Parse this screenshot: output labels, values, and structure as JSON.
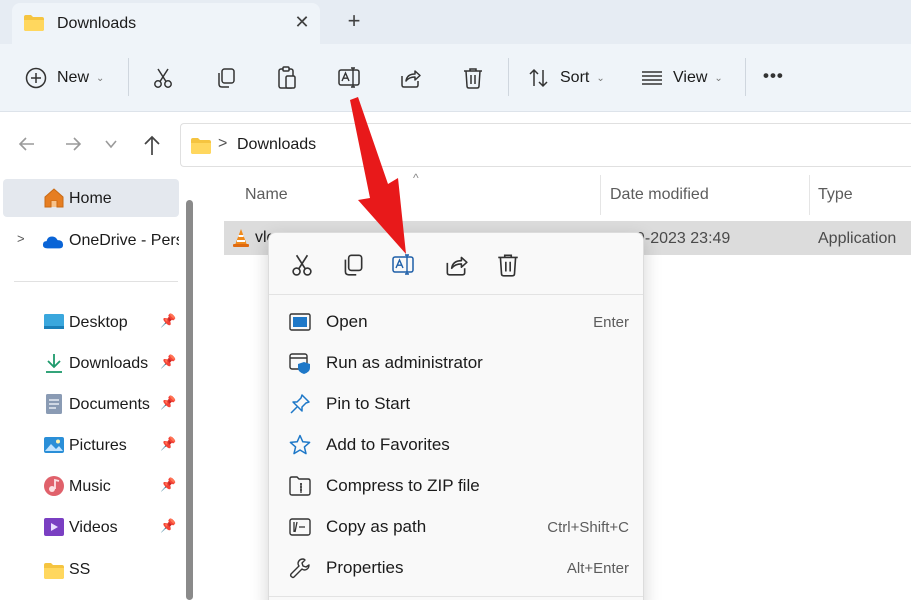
{
  "tab": {
    "title": "Downloads",
    "close": "✕",
    "new_tab": "+"
  },
  "toolbar": {
    "new_label": "New",
    "sort_label": "Sort",
    "view_label": "View",
    "more": "•••",
    "chevron": "⌄"
  },
  "address": {
    "separator": ">",
    "crumb": "Downloads"
  },
  "sidebar": {
    "items": [
      {
        "label": "Home"
      },
      {
        "label": "OneDrive - Perso"
      },
      {
        "label": "Desktop"
      },
      {
        "label": "Downloads"
      },
      {
        "label": "Documents"
      },
      {
        "label": "Pictures"
      },
      {
        "label": "Music"
      },
      {
        "label": "Videos"
      },
      {
        "label": "SS"
      }
    ],
    "expand": ">"
  },
  "columns": {
    "name": "Name",
    "date": "Date modified",
    "type": "Type"
  },
  "file_row": {
    "name": "vlc",
    "date": "9-2023 23:49",
    "type": "Application"
  },
  "context_menu": {
    "items": [
      {
        "label": "Open",
        "shortcut": "Enter"
      },
      {
        "label": "Run as administrator",
        "shortcut": ""
      },
      {
        "label": "Pin to Start",
        "shortcut": ""
      },
      {
        "label": "Add to Favorites",
        "shortcut": ""
      },
      {
        "label": "Compress to ZIP file",
        "shortcut": ""
      },
      {
        "label": "Copy as path",
        "shortcut": "Ctrl+Shift+C"
      },
      {
        "label": "Properties",
        "shortcut": "Alt+Enter"
      }
    ]
  },
  "colors": {
    "accent": "#0067c0",
    "annotation": "#e8191a",
    "folder": "#f5c440"
  }
}
